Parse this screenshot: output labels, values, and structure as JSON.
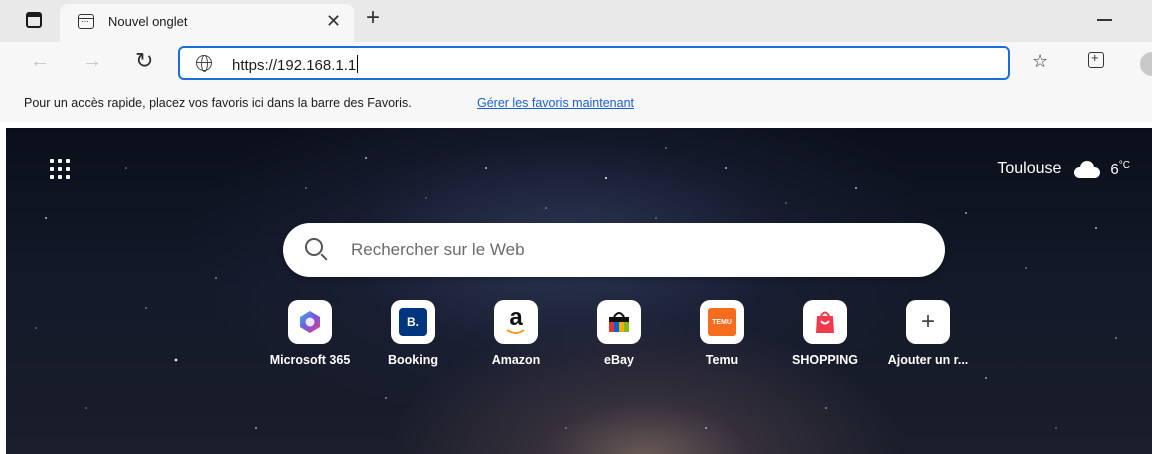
{
  "tab": {
    "title": "Nouvel onglet",
    "close_icon": "close-icon",
    "new_tab_icon": "plus-icon"
  },
  "toolbar": {
    "url": "https://192.168.1.1",
    "back_icon": "arrow-left-icon",
    "forward_icon": "arrow-right-icon",
    "refresh_icon": "refresh-icon"
  },
  "favbar": {
    "text": "Pour un accès rapide, placez vos favoris ici dans la barre des Favoris.",
    "link": "Gérer les favoris maintenant"
  },
  "weather": {
    "city": "Toulouse",
    "temp": "6",
    "unit": "°C"
  },
  "search": {
    "placeholder": "Rechercher sur le Web"
  },
  "tiles": [
    {
      "label": "Microsoft 365",
      "icon": "microsoft-365-icon"
    },
    {
      "label": "Booking",
      "icon": "booking-icon",
      "mark": "B."
    },
    {
      "label": "Amazon",
      "icon": "amazon-icon",
      "mark": "a"
    },
    {
      "label": "eBay",
      "icon": "ebay-icon"
    },
    {
      "label": "Temu",
      "icon": "temu-icon",
      "mark": "TEMU"
    },
    {
      "label": "SHOPPING",
      "icon": "shopping-bag-icon"
    },
    {
      "label": "Ajouter un r...",
      "icon": "plus-icon",
      "mark": "+"
    }
  ],
  "colors": {
    "accent": "#1a6ed8",
    "link": "#1a5fd0",
    "booking": "#003580",
    "temu": "#f56c1c",
    "shopping": "#ef3b4b"
  }
}
